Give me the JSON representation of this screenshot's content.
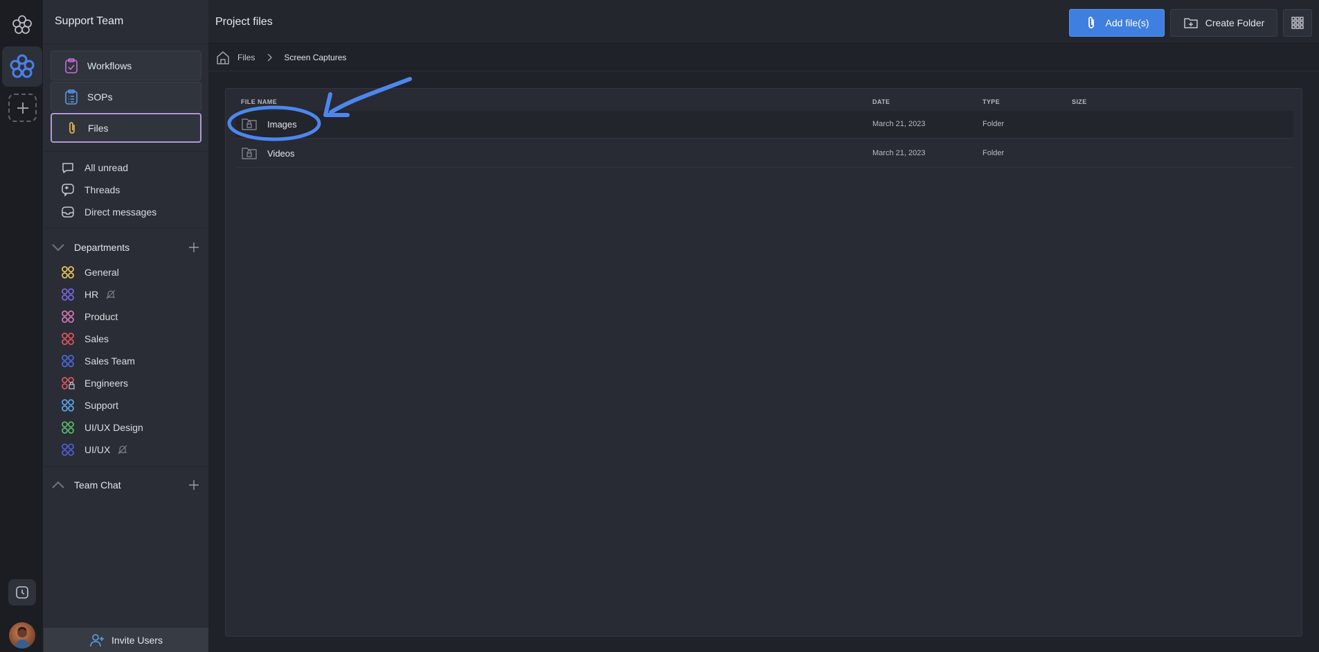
{
  "sidebar": {
    "team_name": "Support Team",
    "nav": [
      {
        "label": "Workflows",
        "icon": "clipboard-check-icon"
      },
      {
        "label": "SOPs",
        "icon": "clipboard-list-icon"
      },
      {
        "label": "Files",
        "icon": "paperclip-icon"
      }
    ],
    "quick": [
      {
        "label": "All unread",
        "icon": "chat-bubble-icon"
      },
      {
        "label": "Threads",
        "icon": "threads-icon"
      },
      {
        "label": "Direct messages",
        "icon": "inbox-icon"
      }
    ],
    "departments_label": "Departments",
    "departments": [
      {
        "label": "General",
        "color": "#e9c25a"
      },
      {
        "label": "HR",
        "color": "#7a64d8"
      },
      {
        "label": "Product",
        "color": "#d276b8"
      },
      {
        "label": "Sales",
        "color": "#e0525f"
      },
      {
        "label": "Sales Team",
        "color": "#4a68d8"
      },
      {
        "label": "Engineers",
        "color": "#d85563"
      },
      {
        "label": "Support",
        "color": "#5aa3e8"
      },
      {
        "label": "UI/UX Design",
        "color": "#59b86a"
      },
      {
        "label": "UI/UX",
        "color": "#4a5fd8"
      }
    ],
    "team_chat_label": "Team Chat",
    "invite_label": "Invite Users"
  },
  "header": {
    "title": "Project files",
    "add_files_label": "Add file(s)",
    "create_folder_label": "Create Folder"
  },
  "breadcrumb": {
    "root": "Files",
    "current": "Screen Captures"
  },
  "table": {
    "columns": [
      "FILE NAME",
      "DATE",
      "TYPE",
      "SIZE"
    ],
    "rows": [
      {
        "name": "Images",
        "date": "March 21, 2023",
        "type": "Folder",
        "size": ""
      },
      {
        "name": "Videos",
        "date": "March 21, 2023",
        "type": "Folder",
        "size": ""
      }
    ]
  },
  "colors": {
    "accent": "#3f7fe0",
    "active_outline": "#b498dc",
    "annotation": "#4d86ee"
  }
}
